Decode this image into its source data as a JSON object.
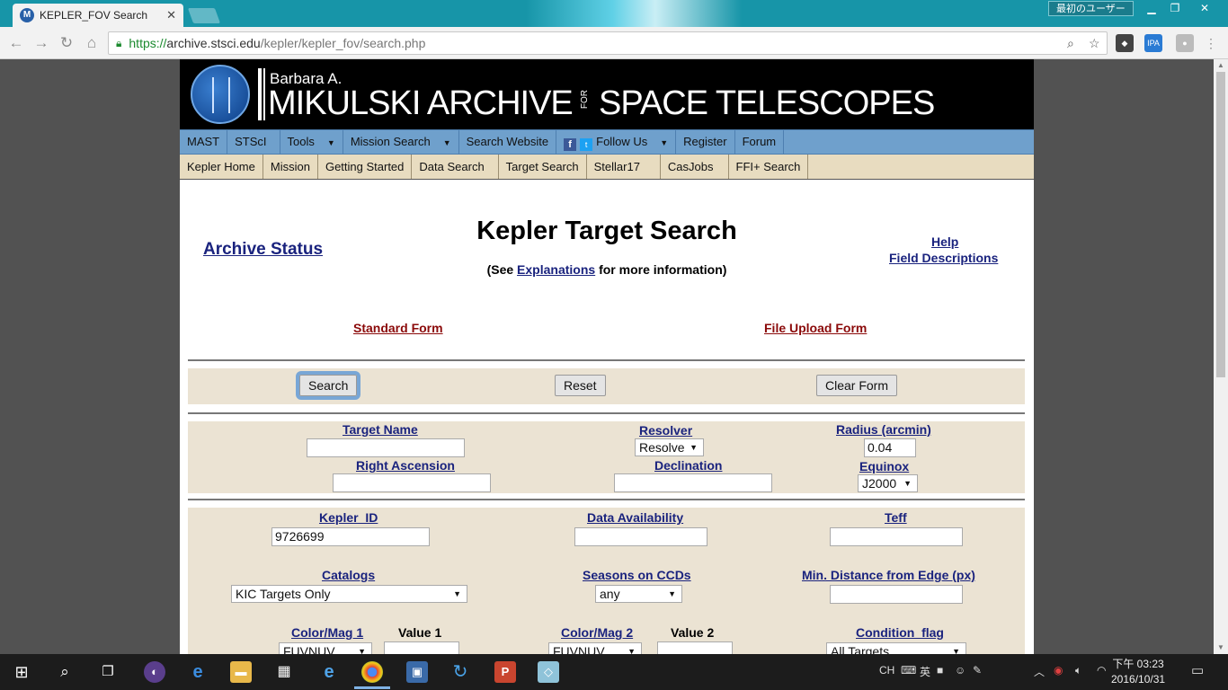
{
  "browser": {
    "tab_title": "KEPLER_FOV Search",
    "tab_close": "✕",
    "favicon_letter": "M",
    "user_button": "最初のユーザー",
    "url_scheme": "https://",
    "url_host": "archive.stsci.edu",
    "url_path": "/kepler/kepler_fov/search.php",
    "ext_label": "IPA"
  },
  "banner": {
    "subtitle": "Barbara A.",
    "title": "MIKULSKI ARCHIVE",
    "for": "FOR",
    "title2": "SPACE TELESCOPES"
  },
  "menu1": {
    "mast": "MAST",
    "stsci": "STScI",
    "tools": "Tools",
    "mission_search": "Mission Search",
    "search_website": "Search Website",
    "follow_us": "Follow Us",
    "register": "Register",
    "forum": "Forum"
  },
  "menu2": [
    "Kepler Home",
    "Mission",
    "Getting Started",
    "Data Search",
    "Target Search",
    "Stellar17",
    "CasJobs",
    "FFI+ Search"
  ],
  "header": {
    "archive_status": "Archive Status",
    "title": "Kepler Target Search",
    "see_prefix": "(See ",
    "explanations": "Explanations",
    "see_suffix": " for more information)",
    "help": "Help",
    "field_descriptions": "Field Descriptions",
    "standard_form": "Standard Form",
    "file_upload_form": "File Upload Form"
  },
  "actions": {
    "search": "Search",
    "reset": "Reset",
    "clear_form": "Clear Form"
  },
  "position": {
    "target_name_label": "Target Name",
    "target_name_value": "",
    "resolver_label": "Resolver",
    "resolver_value": "Resolve",
    "radius_label": "Radius (arcmin)",
    "radius_value": "0.04",
    "ra_label": "Right Ascension",
    "ra_value": "",
    "dec_label": "Declination",
    "dec_value": "",
    "equinox_label": "Equinox",
    "equinox_value": "J2000"
  },
  "fields": {
    "kepler_id_label": "Kepler_ID",
    "kepler_id_value": "9726699",
    "data_availability_label": "Data Availability",
    "teff_label": "Teff",
    "catalogs_label": "Catalogs",
    "catalogs_value": "KIC Targets Only",
    "seasons_label": "Seasons on CCDs",
    "seasons_value": "any",
    "min_distance_label": "Min. Distance from Edge (px)",
    "colormag1_label": "Color/Mag 1",
    "colormag1_value": "FUVNUV",
    "value1_label": "Value 1",
    "colormag2_label": "Color/Mag 2",
    "colormag2_value": "FUVNUV",
    "value2_label": "Value 2",
    "condition_label": "Condition_flag",
    "condition_value": "All Targets"
  },
  "taskbar": {
    "ime_ch": "CH",
    "ime_mode": "英",
    "time_line1": "下午 03:23",
    "time_line2": "2016/10/31"
  },
  "colors": {
    "menu1_bg": "#6fa0cc",
    "menu2_bg": "#e8dcc0",
    "panel_bg": "#ebe3d3",
    "link": "#1a237e",
    "link_red": "#8b0a0a",
    "titlebar": "#1795a8"
  }
}
